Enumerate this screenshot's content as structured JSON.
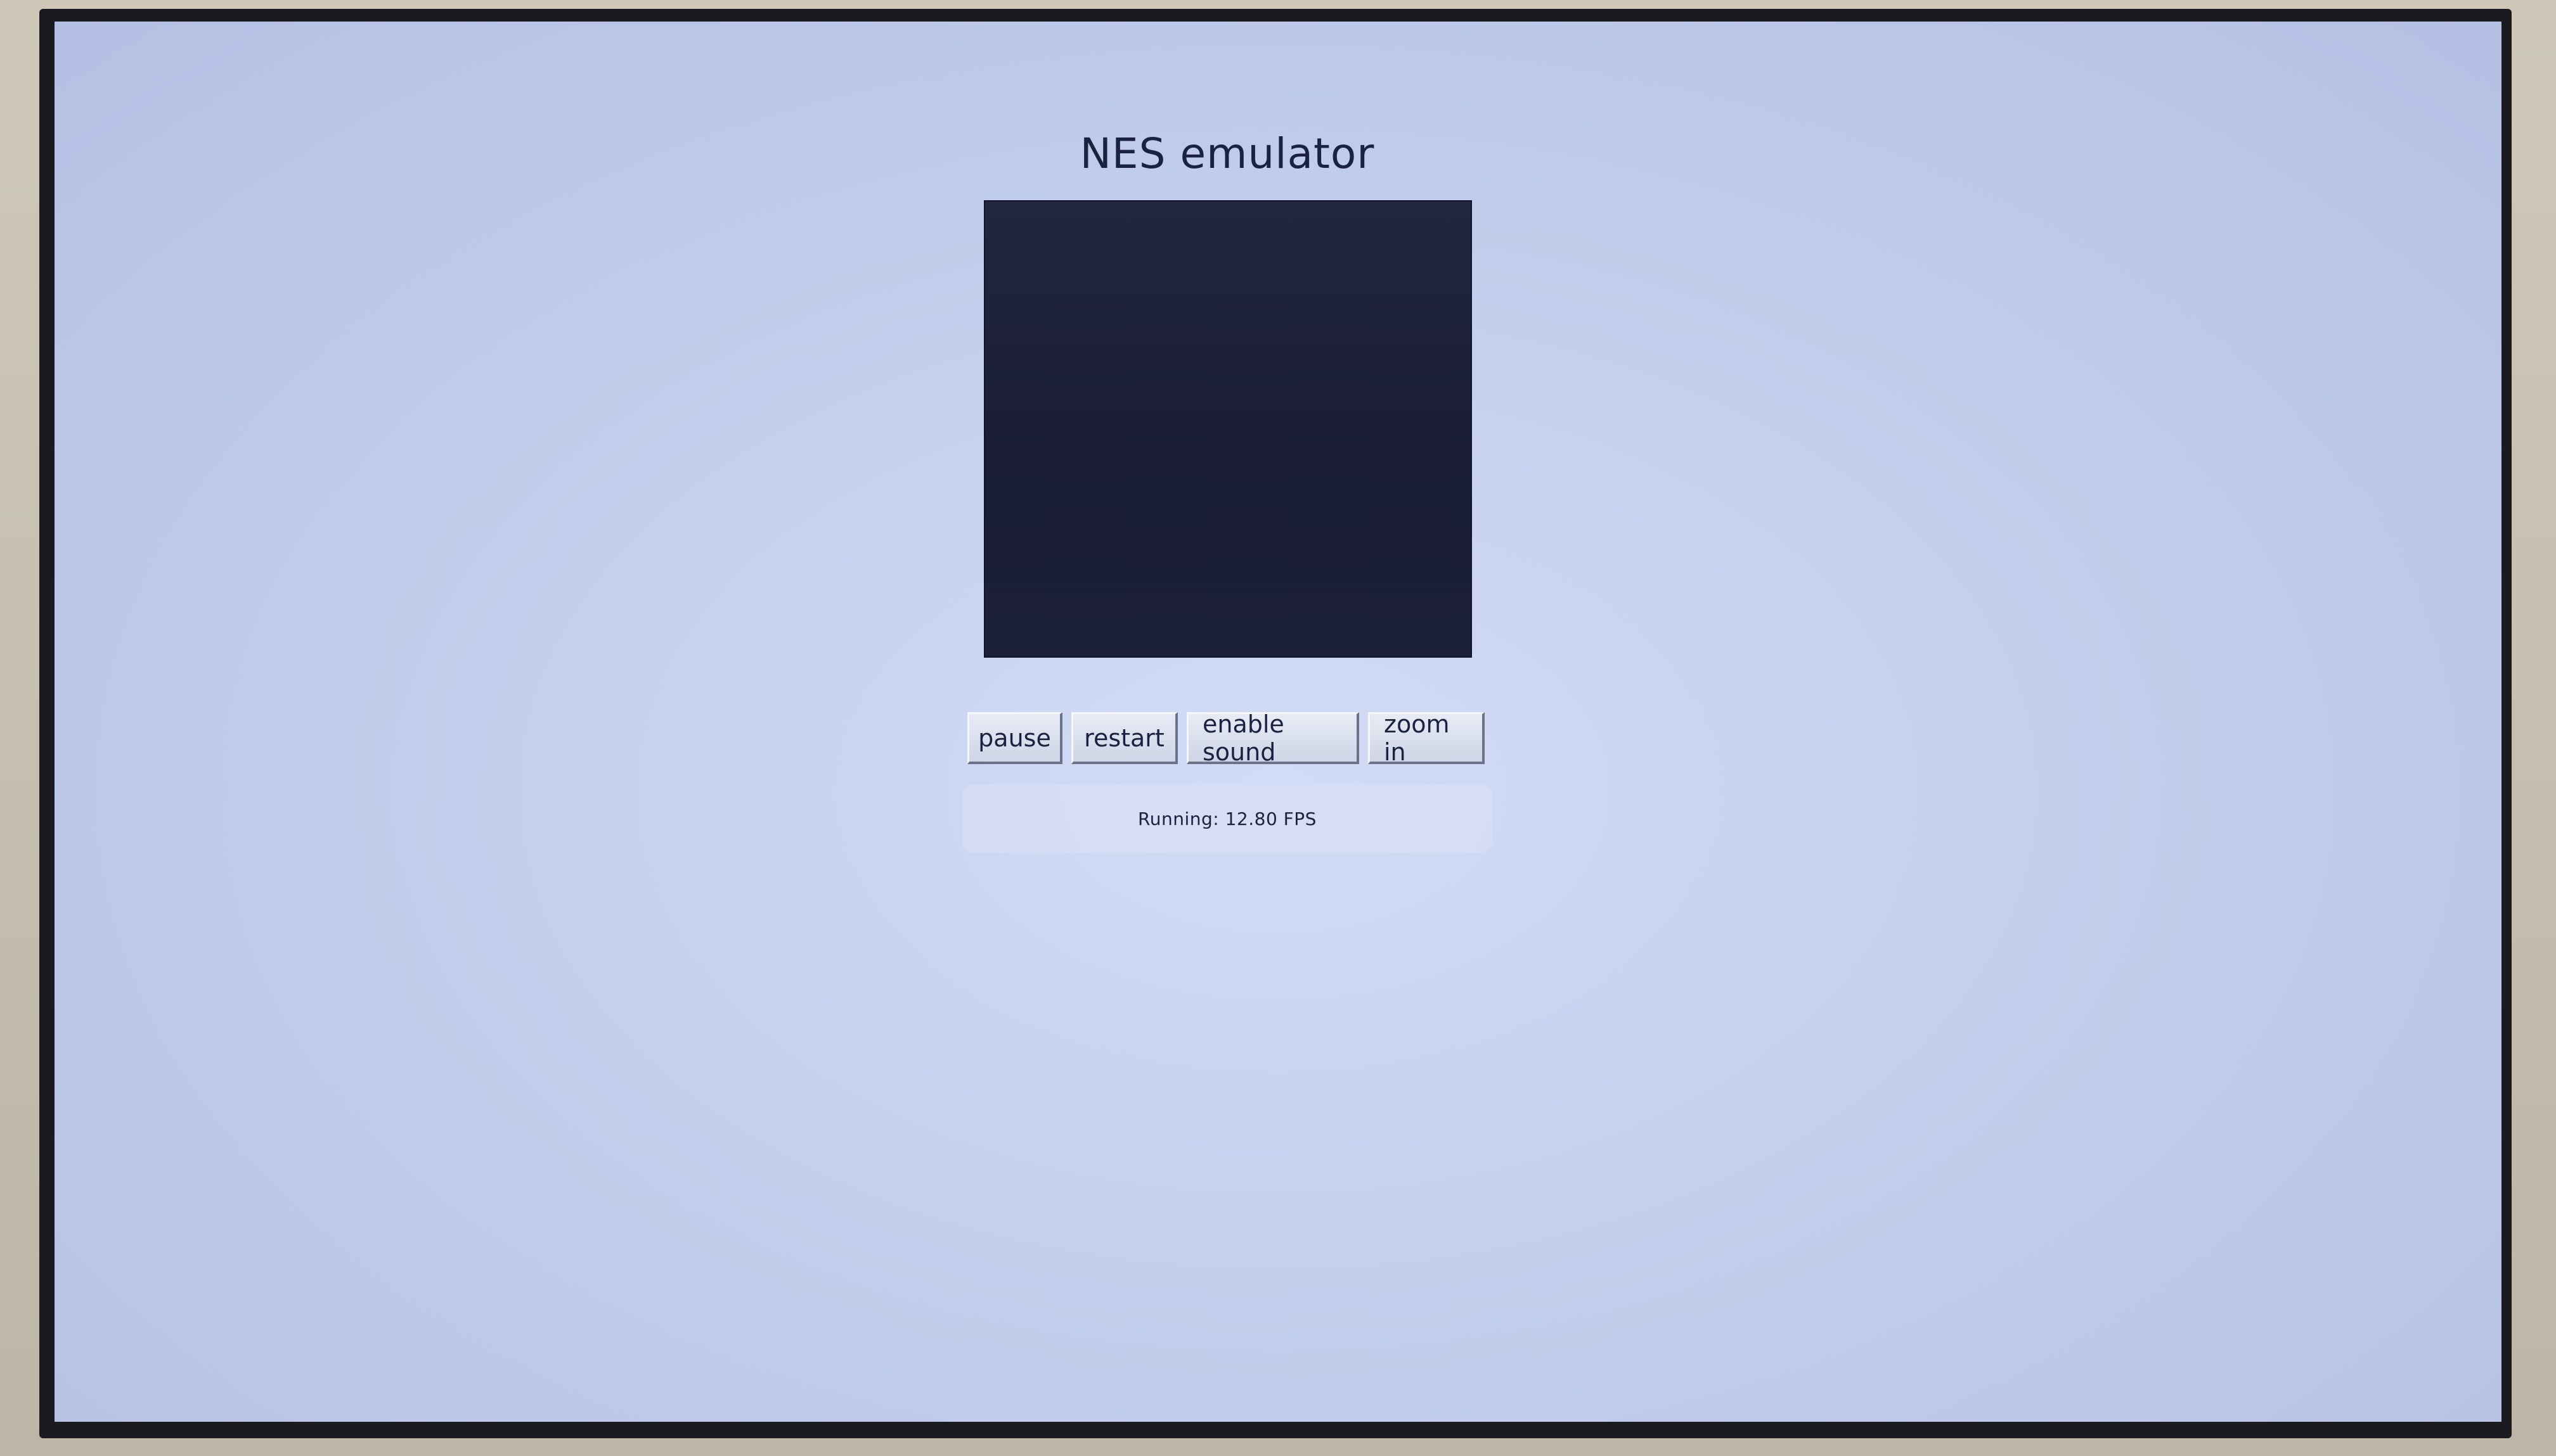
{
  "app": {
    "title": "NES emulator"
  },
  "controls": {
    "pause_label": "pause",
    "restart_label": "restart",
    "sound_label": "enable sound",
    "zoom_label": "zoom in"
  },
  "status": {
    "text": "Running: 12.80 FPS"
  },
  "colors": {
    "screen_background": "#c4cfee",
    "canvas_background": "#1c2038",
    "text": "#1b2140"
  }
}
